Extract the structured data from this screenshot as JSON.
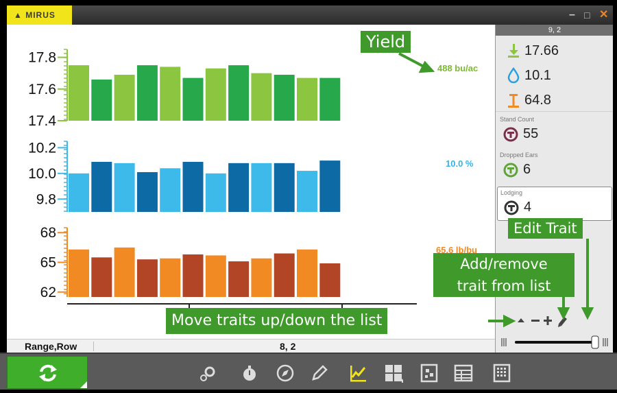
{
  "app": {
    "brand": "MIRUS",
    "minimize": "–",
    "maximize": "□",
    "close": "✕"
  },
  "chart_data": [
    {
      "type": "bar",
      "title": "",
      "ylim": [
        17.4,
        17.85
      ],
      "yticks": [
        "17.8",
        "17.6",
        "17.4"
      ],
      "tick_values": [
        17.8,
        17.6,
        17.4
      ],
      "values": [
        17.75,
        17.66,
        17.69,
        17.75,
        17.74,
        17.67,
        17.73,
        17.75,
        17.7,
        17.69,
        17.67,
        17.67
      ],
      "colors": [
        "#8cc540",
        "#27a84a"
      ],
      "current_label": "488 bu/ac",
      "label_color": "#7dbb2e"
    },
    {
      "type": "bar",
      "title": "",
      "ylim": [
        9.7,
        10.25
      ],
      "yticks": [
        "10.2",
        "10.0",
        "9.8"
      ],
      "tick_values": [
        10.2,
        10.0,
        9.8
      ],
      "values": [
        10.0,
        10.09,
        10.08,
        10.01,
        10.04,
        10.09,
        10.0,
        10.08,
        10.08,
        10.08,
        10.02,
        10.1
      ],
      "colors": [
        "#3db9ea",
        "#0e6aa5"
      ],
      "current_label": "10.0 %",
      "label_color": "#39b2e6"
    },
    {
      "type": "bar",
      "title": "",
      "ylim": [
        61.5,
        68.5
      ],
      "yticks": [
        "68",
        "65",
        "62"
      ],
      "tick_values": [
        68,
        65,
        62
      ],
      "values": [
        66.3,
        65.5,
        66.5,
        65.3,
        65.4,
        65.8,
        65.7,
        65.1,
        65.4,
        65.9,
        66.3,
        64.9
      ],
      "colors": [
        "#f28a24",
        "#b24526"
      ],
      "current_label": "65.6 lb/bu",
      "label_color": "#f28a24"
    }
  ],
  "status": {
    "label": "Range,Row",
    "value": "8, 2"
  },
  "panel": {
    "header": "9, 2",
    "yield": "17.66",
    "moisture": "10.1",
    "test_weight": "64.8",
    "traits": [
      {
        "name": "Stand Count",
        "value": "55",
        "color": "#7a2e4a"
      },
      {
        "name": "Dropped Ears",
        "value": "6",
        "color": "#5fa33a"
      },
      {
        "name": "Lodging",
        "value": "4",
        "color": "#333333"
      }
    ]
  },
  "callouts": {
    "yield": "Yield",
    "edit": "Edit Trait",
    "add_remove_1": "Add/remove",
    "add_remove_2": "trait from list",
    "move": "Move traits up/down the list"
  },
  "icons": [
    "refresh-icon",
    "gear-icon",
    "timer-icon",
    "compass-icon",
    "pencil-icon",
    "chart-icon",
    "grid-icon",
    "map-icon",
    "table-icon",
    "calculator-icon"
  ]
}
